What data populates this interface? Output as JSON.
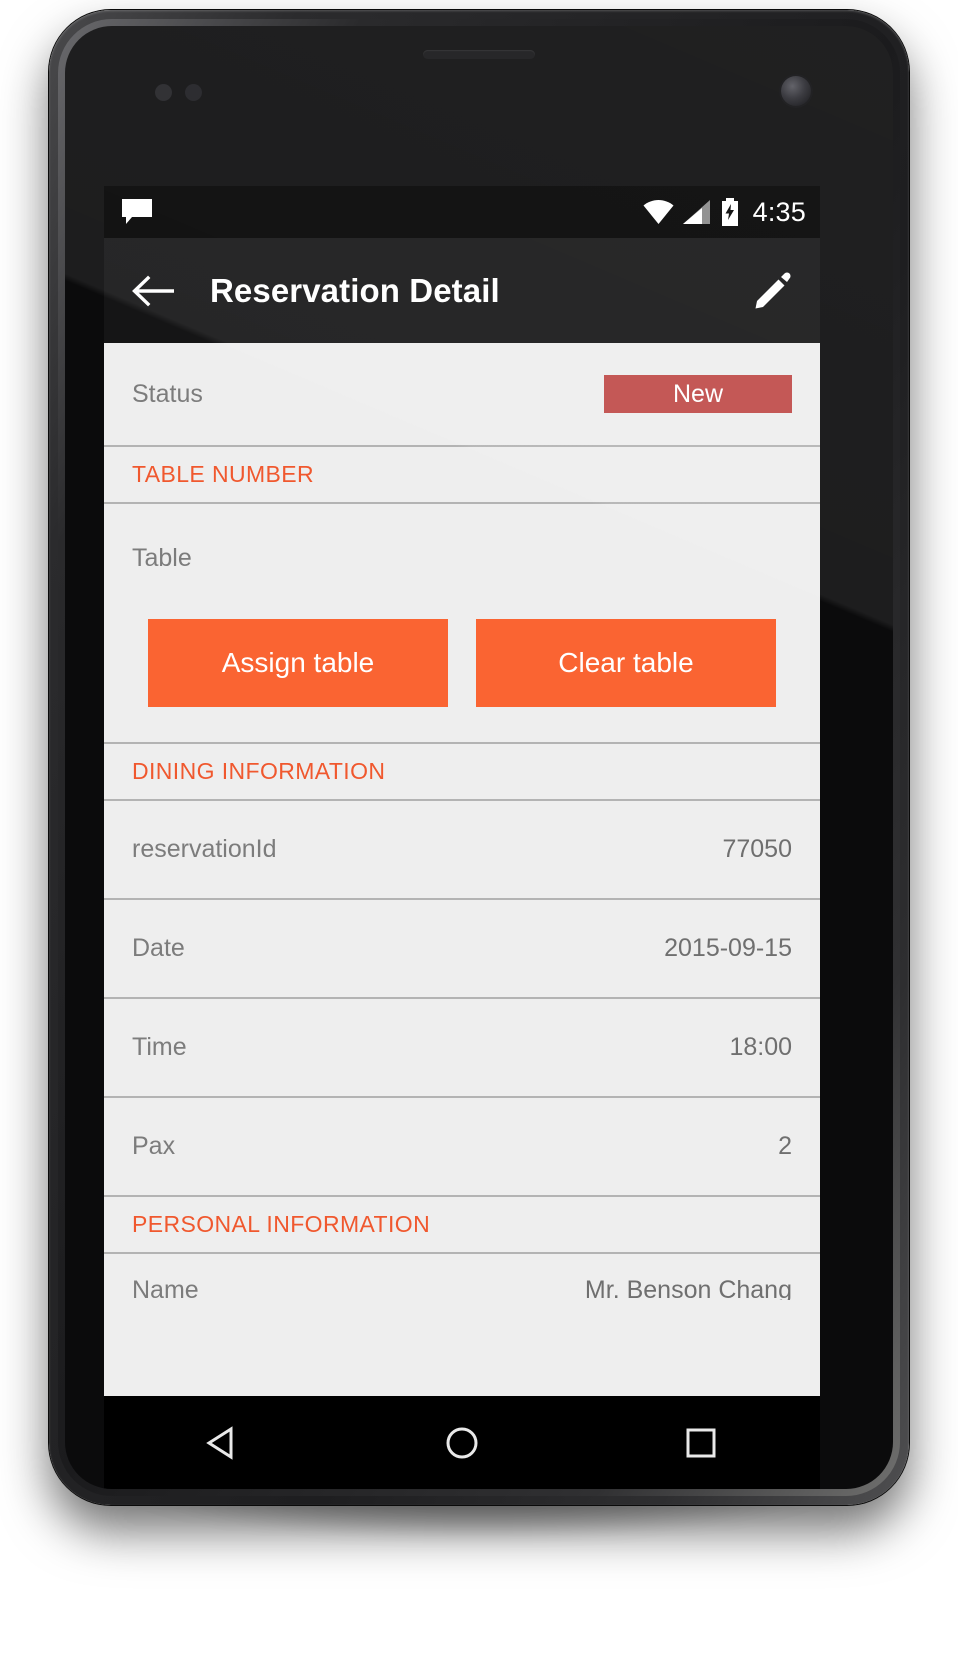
{
  "device": {
    "type": "android-phone-mockup"
  },
  "statusbar": {
    "time": "4:35",
    "icons": {
      "message": "message-icon",
      "wifi": "wifi-icon",
      "signal": "cellular-signal-icon",
      "battery": "battery-charging-icon"
    }
  },
  "appbar": {
    "back_label": "back-arrow",
    "title": "Reservation Detail",
    "edit_label": "edit-pencil"
  },
  "screen": {
    "status_row": {
      "label": "Status",
      "badge_text": "New",
      "badge_color": "#bf4a48"
    },
    "sections": [
      {
        "header": "TABLE NUMBER",
        "table_label": "Table",
        "table_value": "",
        "buttons": [
          {
            "label": "Assign table",
            "color": "#fa6432"
          },
          {
            "label": "Clear table",
            "color": "#fa6432"
          }
        ]
      },
      {
        "header": "DINING INFORMATION",
        "rows": [
          {
            "label": "reservationId",
            "value": "77050"
          },
          {
            "label": "Date",
            "value": "2015-09-15"
          },
          {
            "label": "Time",
            "value": "18:00"
          },
          {
            "label": "Pax",
            "value": "2"
          }
        ]
      },
      {
        "header": "PERSONAL INFORMATION",
        "rows": [
          {
            "label": "Name",
            "value": "Mr. Benson Chang"
          }
        ]
      }
    ]
  },
  "navbar": {
    "back": "triangle-back-icon",
    "home": "circle-home-icon",
    "recents": "square-recents-icon"
  },
  "colors": {
    "accent_orange": "#f0582e",
    "button_orange": "#fa6432",
    "status_red": "#bf4a48",
    "list_bg": "#eeeeee",
    "divider": "#b3b3b3",
    "appbar_bg": "#151516"
  }
}
